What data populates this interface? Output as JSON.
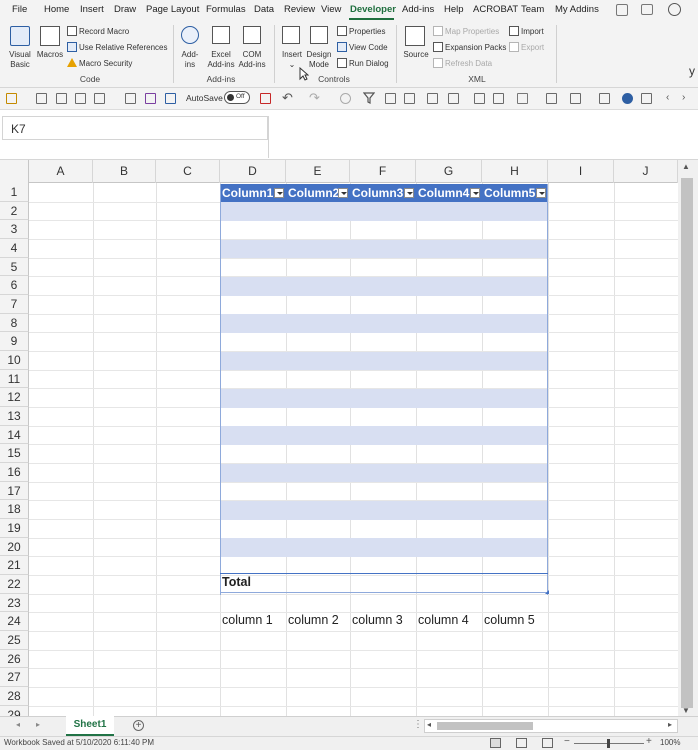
{
  "menu": [
    "File",
    "Home",
    "Insert",
    "Draw",
    "Page Layout",
    "Formulas",
    "Data",
    "Review",
    "View",
    "Developer",
    "Add-ins",
    "Help",
    "ACROBAT",
    "Team",
    "My Addins"
  ],
  "ribbon": {
    "visual_basic": [
      "Visual",
      "Basic"
    ],
    "macros": "Macros",
    "record_macro": "Record Macro",
    "use_relative": "Use Relative References",
    "macro_security": "Macro Security",
    "group_code": "Code",
    "addins": [
      "Add-",
      "ins"
    ],
    "excel_addins": [
      "Excel",
      "Add-ins"
    ],
    "com_addins": [
      "COM",
      "Add-ins"
    ],
    "group_addins": "Add-ins",
    "insert": "Insert",
    "design_mode": [
      "Design",
      "Mode"
    ],
    "properties": "Properties",
    "view_code": "View Code",
    "run_dialog": "Run Dialog",
    "group_controls": "Controls",
    "source": "Source",
    "map_properties": "Map Properties",
    "expansion_packs": "Expansion Packs",
    "refresh_data": "Refresh Data",
    "import": "Import",
    "export": "Export",
    "group_xml": "XML"
  },
  "qat": {
    "autosave": "AutoSave",
    "toggle": "Off"
  },
  "name_box": "K7",
  "columns": [
    "A",
    "B",
    "C",
    "D",
    "E",
    "F",
    "G",
    "H",
    "I",
    "J"
  ],
  "rows": [
    "1",
    "2",
    "3",
    "4",
    "5",
    "6",
    "7",
    "8",
    "9",
    "10",
    "11",
    "12",
    "13",
    "14",
    "15",
    "16",
    "17",
    "18",
    "19",
    "20",
    "21",
    "22",
    "23",
    "24",
    "25",
    "26",
    "27",
    "28",
    "29"
  ],
  "table": {
    "headers": [
      "Column1",
      "Column2",
      "Column3",
      "Column4",
      "Column5"
    ],
    "total_label": "Total",
    "row24": [
      "column 1",
      "column 2",
      "column 3",
      "column 4",
      "column 5"
    ],
    "band_color": "#d8dff2",
    "header_color": "#4472c4"
  },
  "sheet_tab": "Sheet1",
  "status": {
    "saved": "Workbook Saved at 5/10/2020 6:11:40 PM",
    "zoom": "100%"
  },
  "edge_text": {
    "y": "y"
  },
  "colors": {
    "accent": "#1f6f3e",
    "tab_green": "#217346"
  }
}
